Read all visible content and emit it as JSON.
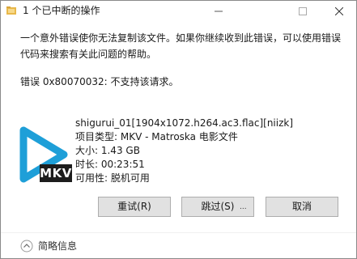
{
  "window": {
    "title": "1 个已中断的操作"
  },
  "message": {
    "text": "一个意外错误使你无法复制该文件。如果你继续收到此错误，可以使用错误代码来搜索有关此问题的帮助。",
    "error_line": "错误 0x80070032: 不支持该请求。"
  },
  "file": {
    "name": "shigurui_01[1904x1072.h264.ac3.flac][niizk]",
    "type": "项目类型: MKV - Matroska 电影文件",
    "size": "大小: 1.43 GB",
    "duration": "时长: 00:23:51",
    "availability": "可用性: 脱机可用",
    "badge": "MKV",
    "accent_color": "#1e9fd8"
  },
  "buttons": {
    "retry": "重试(R)",
    "skip": "跳过(S)",
    "skip_extra": "...",
    "cancel": "取消"
  },
  "footer": {
    "label": "简略信息"
  },
  "icons": {
    "title": "copy-folder-icon",
    "minimize": "minimize-icon",
    "maximize": "maximize-icon",
    "close": "close-icon",
    "thumbnail": "play-icon",
    "footer": "chevron-up-icon"
  }
}
